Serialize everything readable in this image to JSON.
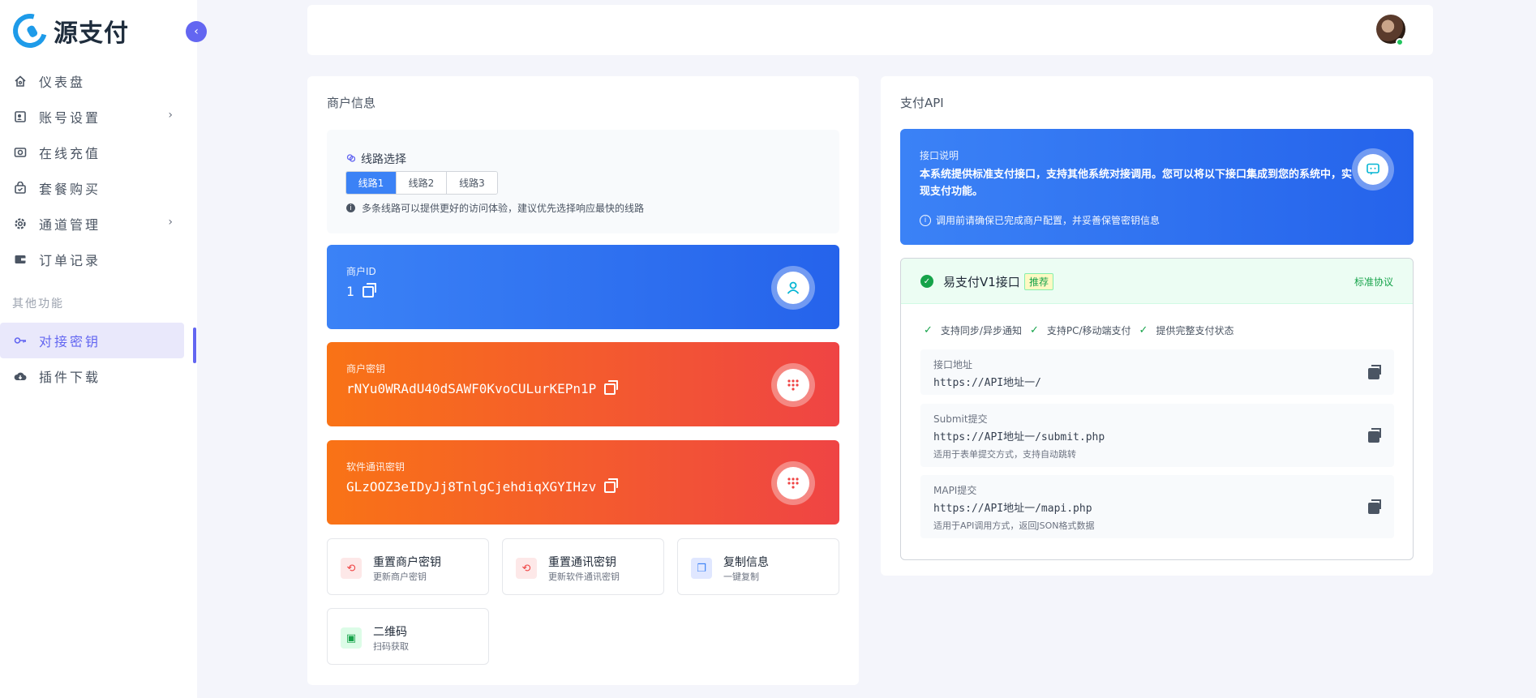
{
  "sidebar": {
    "logo_text": "源支付",
    "items": [
      {
        "label": "仪表盘",
        "icon": "home-icon"
      },
      {
        "label": "账号设置",
        "icon": "id-card-icon",
        "chevron": "›"
      },
      {
        "label": "在线充值",
        "icon": "camera-icon"
      },
      {
        "label": "套餐购买",
        "icon": "bag-icon"
      },
      {
        "label": "通道管理",
        "icon": "gear-icon",
        "chevron": "›"
      },
      {
        "label": "订单记录",
        "icon": "wallet-icon"
      }
    ],
    "section_other": "其他功能",
    "other_items": [
      {
        "label": "对接密钥",
        "icon": "key-icon",
        "active": true
      },
      {
        "label": "插件下载",
        "icon": "cloud-download-icon"
      }
    ],
    "collapse_glyph": "‹"
  },
  "merchant": {
    "title": "商户信息",
    "route": {
      "title": "线路选择",
      "tabs": [
        "线路1",
        "线路2",
        "线路3"
      ],
      "active_tab": 0,
      "note": "多条线路可以提供更好的访问体验，建议优先选择响应最快的线路"
    },
    "id": {
      "label": "商户ID",
      "value": "1"
    },
    "secret": {
      "label": "商户密钥",
      "value": "rNYu0WRAdU40dSAWF0KvoCULurKEPn1P"
    },
    "soft": {
      "label": "软件通讯密钥",
      "value": "GLzOOZ3eIDyJj8TnlgCjehdiqXGYIHzv"
    },
    "actions": [
      {
        "title": "重置商户密钥",
        "sub": "更新商户密钥"
      },
      {
        "title": "重置通讯密钥",
        "sub": "更新软件通讯密钥"
      },
      {
        "title": "复制信息",
        "sub": "一键复制"
      },
      {
        "title": "二维码",
        "sub": "扫码获取"
      }
    ]
  },
  "api": {
    "title": "支付API",
    "desc": {
      "label": "接口说明",
      "text": "本系统提供标准支付接口，支持其他系统对接调用。您可以将以下接口集成到您的系统中，实现支付功能。",
      "note": "调用前请确保已完成商户配置，并妥善保管密钥信息"
    },
    "protocol": {
      "name": "易支付V1接口",
      "tag": "推荐",
      "std": "标准协议",
      "features": [
        "支持同步/异步通知",
        "支持PC/移动端支付",
        "提供完整支付状态"
      ],
      "endpoints": [
        {
          "label": "接口地址",
          "url": "https://API地址一/",
          "desc": ""
        },
        {
          "label": "Submit提交",
          "url": "https://API地址一/submit.php",
          "desc": "适用于表单提交方式，支持自动跳转"
        },
        {
          "label": "MAPI提交",
          "url": "https://API地址一/mapi.php",
          "desc": "适用于API调用方式，返回JSON格式数据"
        }
      ]
    }
  },
  "colors": {
    "accent": "#6366f1",
    "blue": "#3b82f6",
    "orange": "#f97316",
    "red": "#ef4444",
    "green": "#16a34a"
  }
}
